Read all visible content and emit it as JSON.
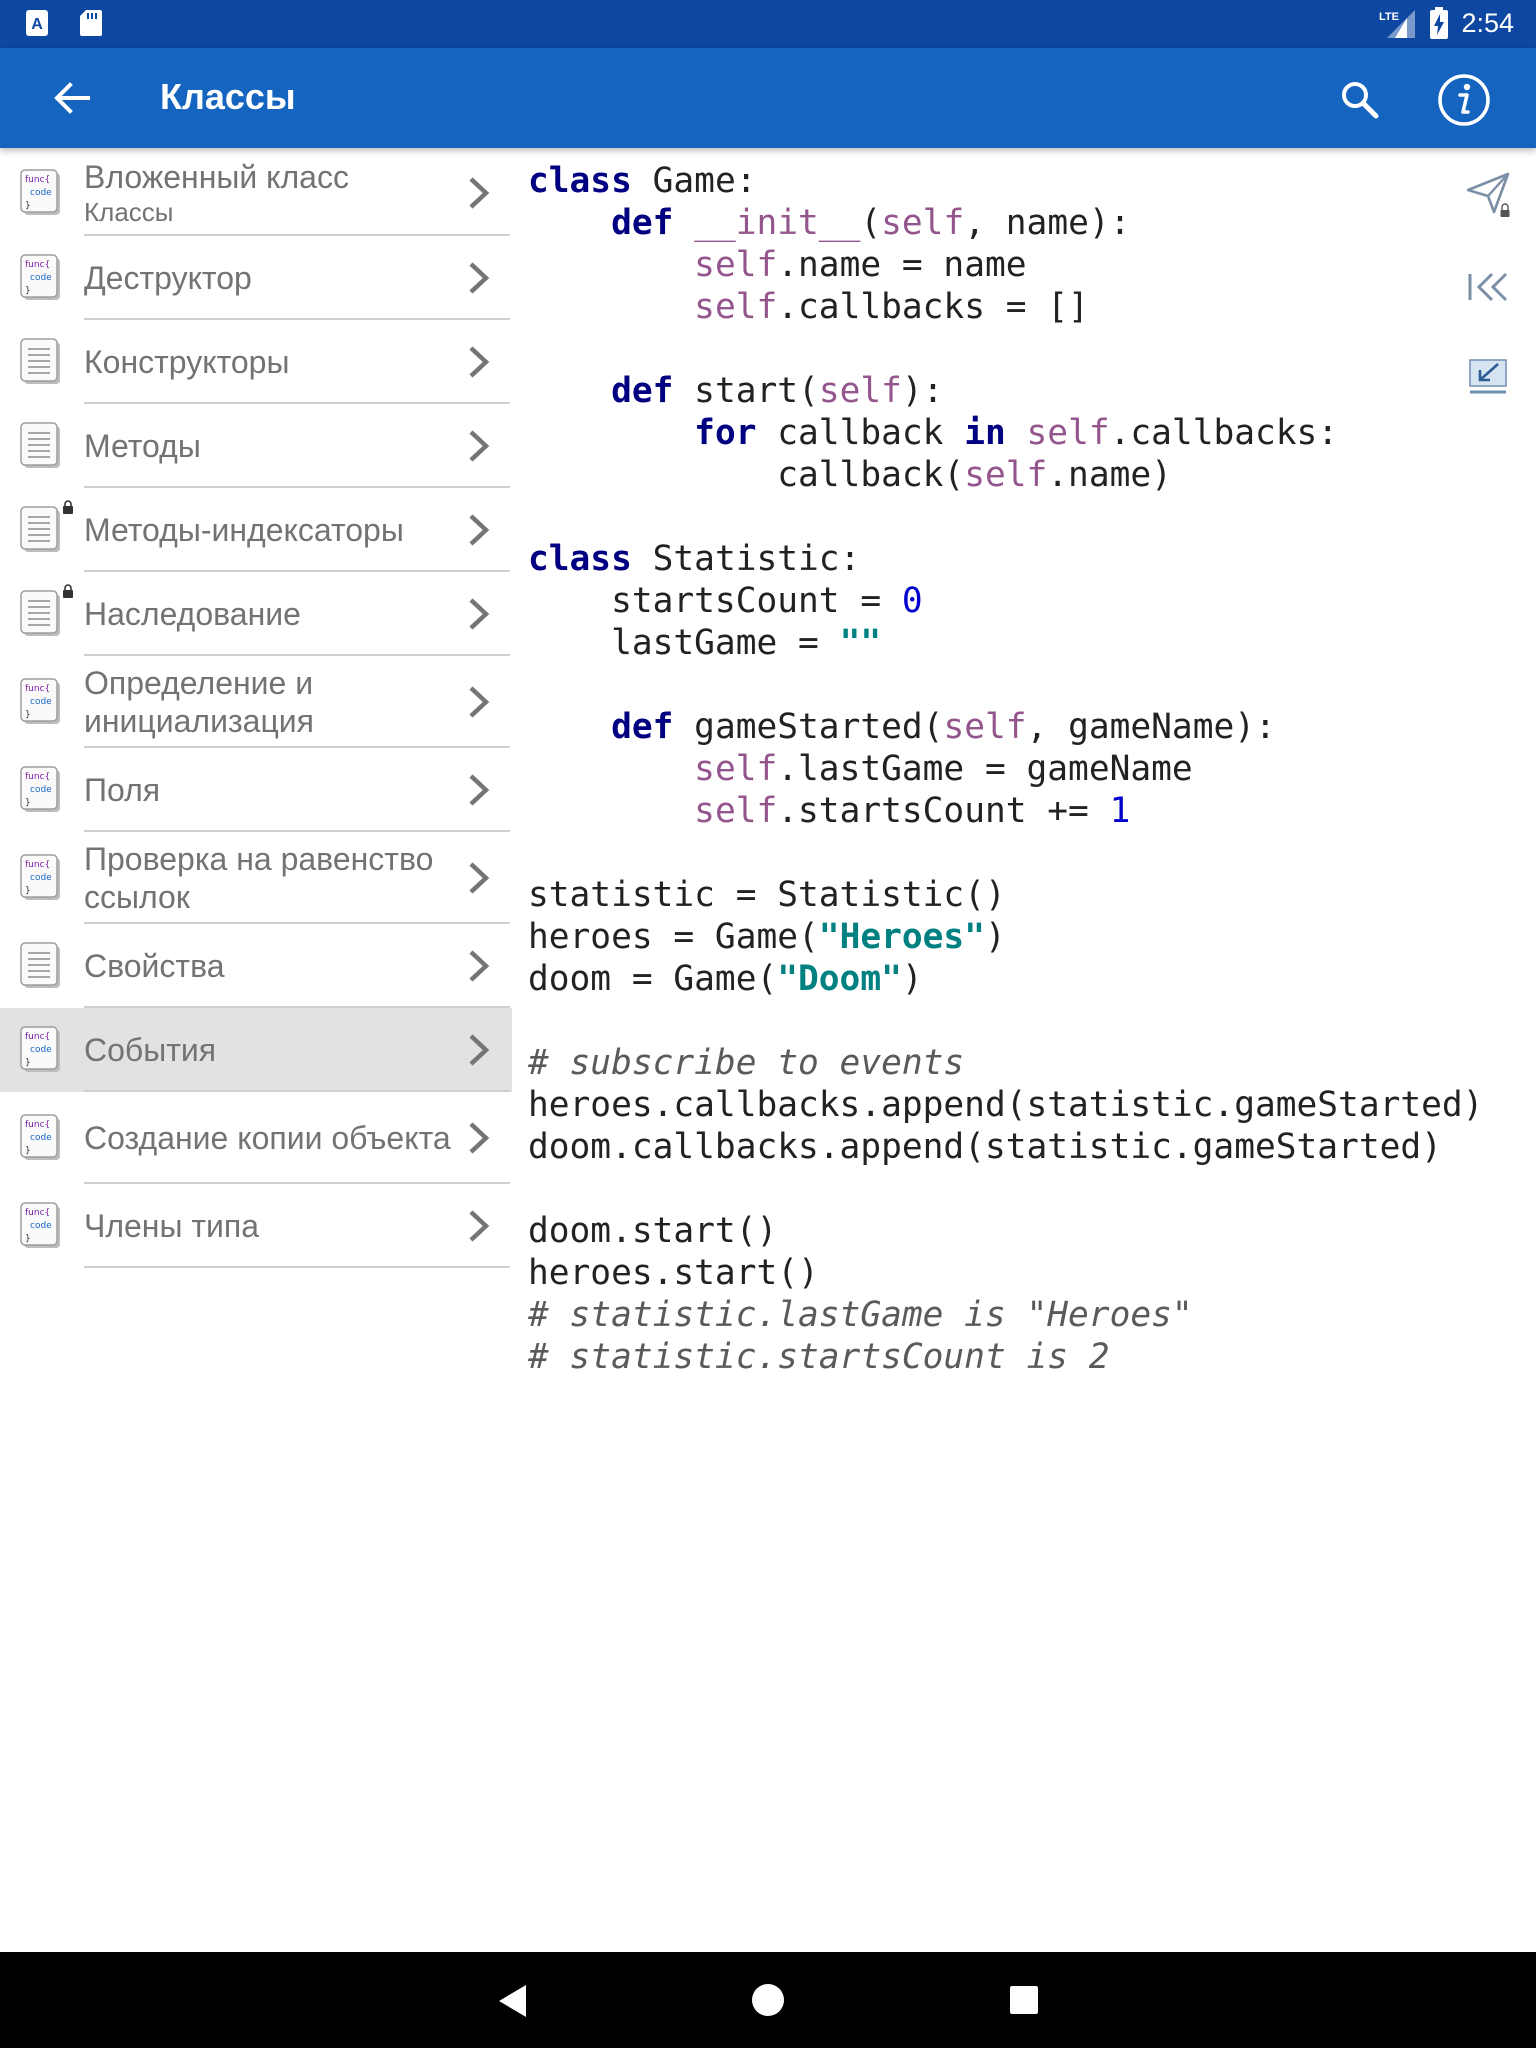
{
  "status_bar": {
    "time": "2:54",
    "network": "LTE",
    "left_icons": [
      "app-notification-icon",
      "sd-card-icon"
    ],
    "right_icons": [
      "lte-signal-icon",
      "battery-charging-icon"
    ]
  },
  "app_bar": {
    "title": "Классы",
    "back_icon": "arrow-back-icon",
    "actions": [
      "search-icon",
      "info-icon"
    ]
  },
  "sidebar": {
    "items": [
      {
        "label": "Вложенный класс",
        "sublabel": "Классы",
        "icon": "func-code-icon",
        "locked": false
      },
      {
        "label": "Деструктор",
        "icon": "func-code-icon",
        "locked": false
      },
      {
        "label": "Конструкторы",
        "icon": "document-icon",
        "locked": false
      },
      {
        "label": "Методы",
        "icon": "document-icon",
        "locked": false
      },
      {
        "label": "Методы-индексаторы",
        "icon": "document-icon",
        "locked": true
      },
      {
        "label": "Наследование",
        "icon": "document-icon",
        "locked": true
      },
      {
        "label": "Определение и инициализация",
        "icon": "func-code-icon",
        "locked": false
      },
      {
        "label": "Поля",
        "icon": "func-code-icon",
        "locked": false
      },
      {
        "label": "Проверка на равенство ссылок",
        "icon": "func-code-icon",
        "locked": false
      },
      {
        "label": "Свойства",
        "icon": "document-icon",
        "locked": false
      },
      {
        "label": "События",
        "icon": "func-code-icon",
        "locked": false,
        "selected": true
      },
      {
        "label": "Создание копии объекта",
        "icon": "func-code-icon",
        "locked": false
      },
      {
        "label": "Члены типа",
        "icon": "func-code-icon",
        "locked": false
      }
    ]
  },
  "code": {
    "lines": [
      "class Game:",
      "    def __init__(self, name):",
      "        self.name = name",
      "        self.callbacks = []",
      "",
      "    def start(self):",
      "        for callback in self.callbacks:",
      "            callback(self.name)",
      "",
      "class Statistic:",
      "    startsCount = 0",
      "    lastGame = \"\"",
      "",
      "    def gameStarted(self, gameName):",
      "        self.lastGame = gameName",
      "        self.startsCount += 1",
      "",
      "statistic = Statistic()",
      "heroes = Game(\"Heroes\")",
      "doom = Game(\"Doom\")",
      "",
      "# subscribe to events",
      "heroes.callbacks.append(statistic.gameStarted)",
      "doom.callbacks.append(statistic.gameStarted)",
      "",
      "doom.start()",
      "heroes.start()",
      "# statistic.lastGame is \"Heroes\"",
      "# statistic.startsCount is 2"
    ]
  },
  "tools": [
    "send-icon",
    "collapse-left-icon",
    "minimize-icon"
  ],
  "nav_bar": [
    "nav-back-icon",
    "nav-home-icon",
    "nav-recents-icon"
  ],
  "colors": {
    "status_bar": "#0d47a1",
    "app_bar": "#1565c0",
    "keyword": "#000080",
    "self": "#94558d",
    "number": "#0000cc",
    "string": "#008080",
    "comment": "#5a5a5a",
    "selected_row": "#e2e2e2"
  }
}
